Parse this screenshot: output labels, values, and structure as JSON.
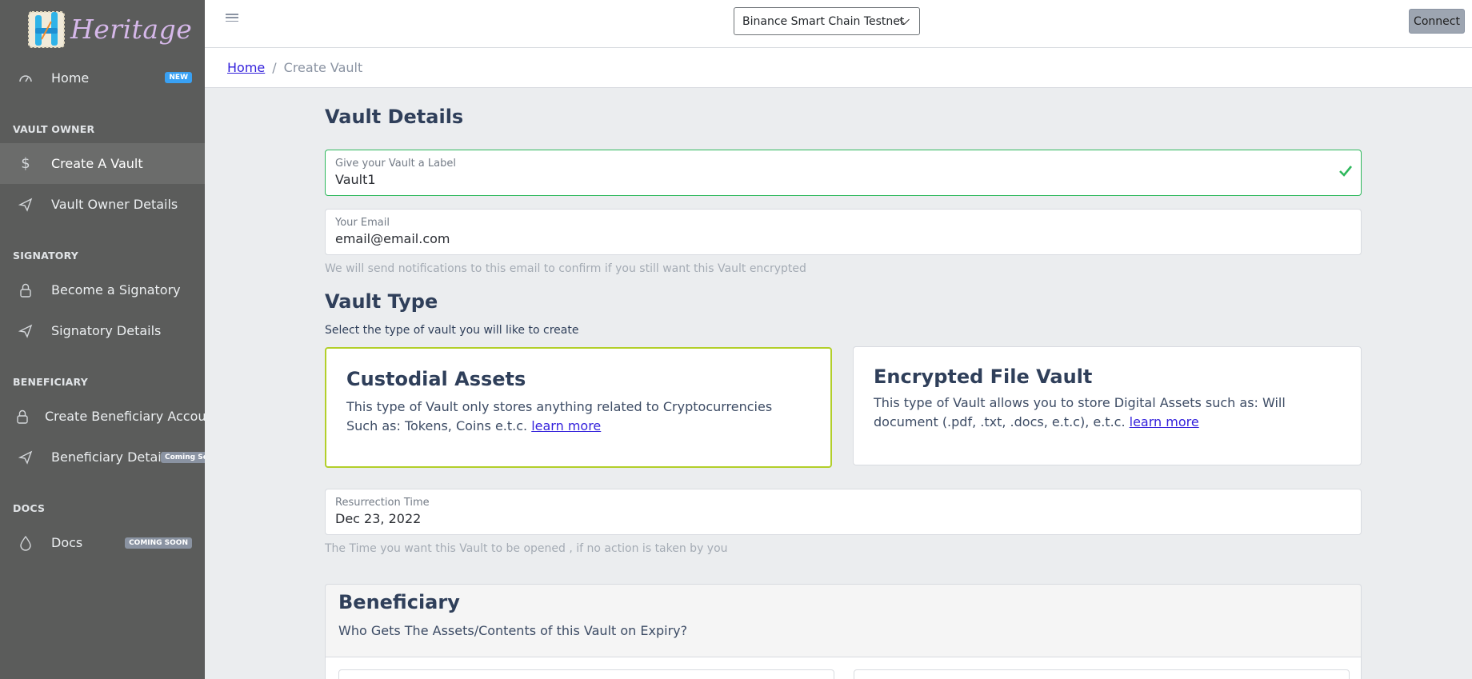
{
  "app": {
    "name": "Heritage"
  },
  "sidebar": {
    "home": {
      "label": "Home",
      "badge": "NEW"
    },
    "sections": {
      "vault_owner": "VAULT OWNER",
      "signatory": "SIGNATORY",
      "beneficiary": "BENEFICIARY",
      "docs": "DOCS"
    },
    "items": {
      "create_vault": "Create A Vault",
      "vault_owner_details": "Vault Owner Details",
      "become_signatory": "Become a Signatory",
      "signatory_details": "Signatory Details",
      "create_beneficiary": "Create Beneficiary Account",
      "beneficiary_details": "Beneficiary Details",
      "beneficiary_details_badge": "Coming Soon",
      "docs": "Docs",
      "docs_badge": "COMING SOON"
    }
  },
  "header": {
    "network": "Binance Smart Chain Testnet",
    "connect": "Connect"
  },
  "breadcrumb": {
    "home": "Home",
    "separator": "/",
    "current": "Create Vault"
  },
  "vault_details": {
    "title": "Vault Details",
    "label_field": {
      "label": "Give your Vault a Label",
      "value": "Vault1"
    },
    "email_field": {
      "label": "Your Email",
      "value": "email@email.com"
    },
    "email_help": "We will send notifications to this email to confirm if you still want this Vault encrypted"
  },
  "vault_type": {
    "title": "Vault Type",
    "description": "Select the type of vault you will like to create",
    "cards": [
      {
        "title": "Custodial Assets",
        "text": "This type of Vault only stores anything related to Cryptocurrencies Such as: Tokens, Coins e.t.c.",
        "link": "learn more"
      },
      {
        "title": "Encrypted File Vault",
        "text": "This type of Vault allows you to store Digital Assets such as: Will document (.pdf, .txt, .docs, e.t.c), e.t.c.",
        "link": "learn more"
      }
    ]
  },
  "resurrection": {
    "label": "Resurrection Time",
    "value": "Dec 23, 2022",
    "help": "The Time you want this Vault to be opened , if no action is taken by you"
  },
  "beneficiary": {
    "title": "Beneficiary",
    "subtitle": "Who Gets The Assets/Contents of this Vault on Expiry?"
  },
  "colors": {
    "sidebar": "#5b5c5b",
    "selected_card_border": "#b2cf2a",
    "valid_border": "#2eb85c",
    "link": "#321fdb"
  }
}
